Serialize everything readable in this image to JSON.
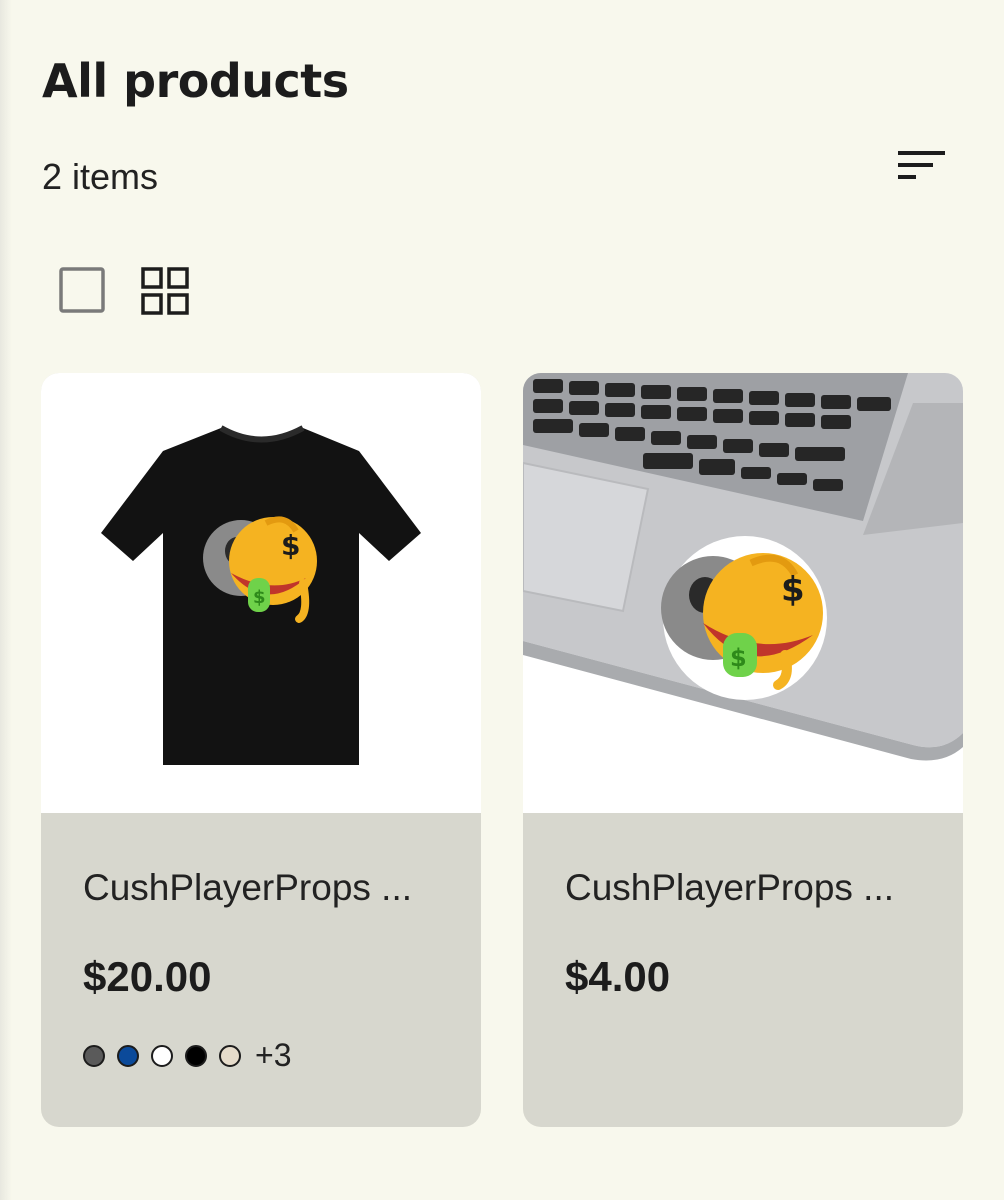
{
  "header": {
    "title": "All products",
    "item_count": "2 items"
  },
  "toolbar": {
    "sort_icon": "sort-lines-icon",
    "view_single_icon": "single-view-icon",
    "view_grid_icon": "grid-view-icon"
  },
  "products": [
    {
      "name": "CushPlayerProps ...",
      "price": "$20.00",
      "image": "black-tshirt-with-skull-money-emoji",
      "swatches": [
        "#5a5a5a",
        "#0b4a9a",
        "#ffffff",
        "#000000",
        "#e6dccb"
      ],
      "more_colors": "+3"
    },
    {
      "name": "CushPlayerProps ...",
      "price": "$4.00",
      "image": "sticker-on-laptop-skull-money-emoji"
    }
  ],
  "colors": {
    "background": "#f8f8ed",
    "card_footer": "#d7d7ce",
    "emoji_yellow": "#f5b321",
    "emoji_green": "#6fd24a"
  }
}
